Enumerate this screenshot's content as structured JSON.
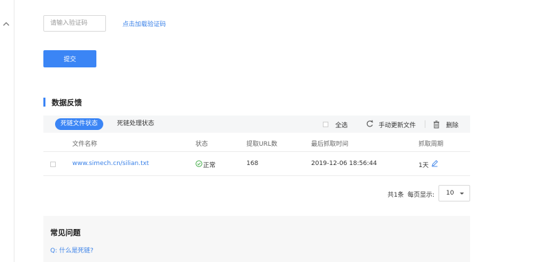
{
  "nav": {
    "collapse_glyph": "^"
  },
  "captcha": {
    "placeholder": "请输入验证码",
    "value": "",
    "load_link": "点击加载验证码"
  },
  "form": {
    "submit_label": "提交"
  },
  "section": {
    "title": "数据反馈"
  },
  "toolbar": {
    "tabs": [
      {
        "label": "死链文件状态",
        "active": true
      },
      {
        "label": "死链处理状态",
        "active": false
      }
    ],
    "select_all_label": "全选",
    "update_label": "手动更新文件",
    "delete_label": "删除"
  },
  "table": {
    "columns": [
      "文件名称",
      "状态",
      "提取URL数",
      "最后抓取时间",
      "抓取周期"
    ],
    "rows": [
      {
        "file_name": "www.simech.cn/silian.txt",
        "status": "正常",
        "url_count": "168",
        "last_crawl": "2019-12-06 18:56:44",
        "crawl_period": "1天"
      }
    ]
  },
  "pagination": {
    "total": "共1条",
    "page_size_label": "每页显示:",
    "page_size": "10"
  },
  "faq": {
    "title": "常见问题",
    "question": "Q:  什么是死链?"
  },
  "colors": {
    "accent": "#3b85f5",
    "link": "#3b82e8",
    "status_ok": "#4caf50"
  },
  "icons": [
    "chevron-up-icon",
    "refresh-icon",
    "trash-icon",
    "check-circle-icon",
    "pencil-icon",
    "caret-down-icon"
  ]
}
